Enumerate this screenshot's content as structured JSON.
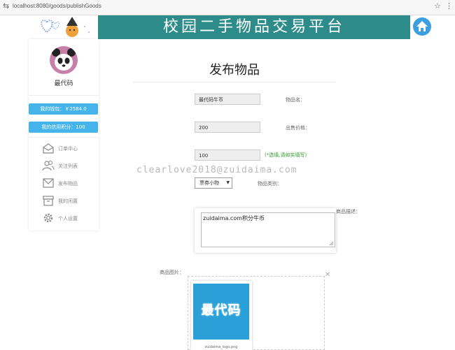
{
  "browser": {
    "url": "localhost:8080/goods/publishGoods"
  },
  "header": {
    "title": "校园二手物品交易平台"
  },
  "sidebar": {
    "username": "最代码",
    "wallet_label": "我的钱包：￥2584.0",
    "credit_label": "我的信用积分：100",
    "menu": [
      {
        "label": "订单中心",
        "icon": "envelope-open-icon"
      },
      {
        "label": "关注列表",
        "icon": "users-icon"
      },
      {
        "label": "发布物品",
        "icon": "mail-icon"
      },
      {
        "label": "我的闲置",
        "icon": "archive-box-icon"
      },
      {
        "label": "个人设置",
        "icon": "gear-icon"
      }
    ]
  },
  "form": {
    "page_title": "发布物品",
    "name": {
      "value": "最代码牛币",
      "label": "物品名："
    },
    "price": {
      "value": "200",
      "label": "出售价格："
    },
    "original_price": {
      "value": "100",
      "hint": "(*选填,请如实填写)"
    },
    "category": {
      "value": "票券小物",
      "label": "物品类别："
    },
    "description": {
      "value": "zuidaima.com积分牛币",
      "label": "商品描述："
    },
    "image": {
      "label": "商品图片：",
      "thumb_text": "最代码",
      "filename": "zuidaima_logo.png"
    }
  },
  "watermark": "clearlove2018@zuidaima.com",
  "colors": {
    "banner": "#2d8c8a",
    "pill": "#45b4ea",
    "hint": "#2ca02c"
  }
}
